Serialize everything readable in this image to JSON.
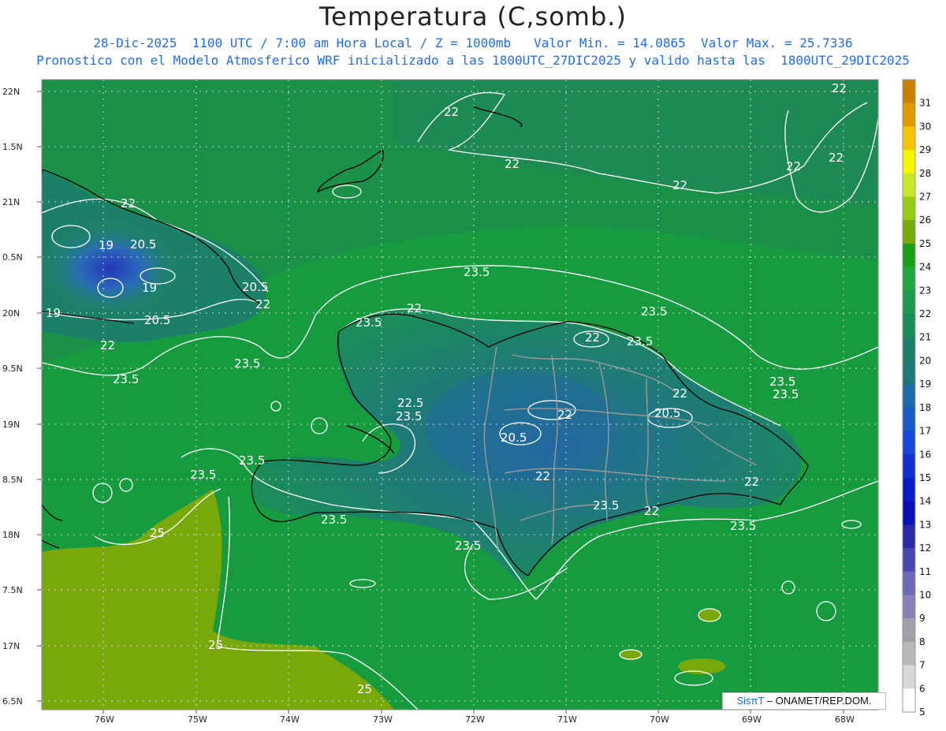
{
  "header": {
    "title": "Temperatura (C,somb.)",
    "subtitle_line1": "28-Dic-2025  1100 UTC / 7:00 am Hora Local / Z = 1000mb   Valor Min. = 14.0865  Valor Max. = 25.7336",
    "subtitle_line2": "Pronostico con el Modelo Atmosferico WRF inicializado a las 1800UTC_27DIC2025 y valido hasta las  1800UTC_29DIC2025"
  },
  "map": {
    "lat_labels": [
      "22N",
      "1.5N",
      "21N",
      "0.5N",
      "20N",
      "9.5N",
      "19N",
      "8.5N",
      "18N",
      "7.5N",
      "17N",
      "6.5N"
    ],
    "lon_labels": [
      "76W",
      "75W",
      "74W",
      "73W",
      "72W",
      "71W",
      "70W",
      "69W",
      "68W"
    ],
    "contour_labels": [
      "22",
      "22",
      "22",
      "22",
      "22",
      "22",
      "19",
      "20.5",
      "19",
      "20.5",
      "19",
      "20.5",
      "22",
      "22",
      "23.5",
      "23.5",
      "22",
      "23.5",
      "23.5",
      "23.5",
      "22",
      "23.5",
      "23.5",
      "22.5",
      "22",
      "23.5",
      "23.5",
      "20.5",
      "20.5",
      "22",
      "22",
      "22",
      "22",
      "23.5",
      "23.5",
      "23.5",
      "22",
      "23.5",
      "25",
      "25",
      "25"
    ],
    "colors": {
      "sea_deep": "#179b3f",
      "sea_cool": "#1c8e50",
      "land_warm": "#78a80a",
      "cold_blue": "#2a6bb8",
      "contour": "#ffffff",
      "border": "#888888",
      "coast": "#000000"
    }
  },
  "colorbar": {
    "labels": [
      "31",
      "30",
      "29",
      "28",
      "27",
      "26",
      "25",
      "24",
      "23",
      "22",
      "21",
      "20",
      "19",
      "18",
      "17",
      "16",
      "15",
      "14",
      "13",
      "12",
      "11",
      "10",
      "9",
      "8",
      "7",
      "6",
      "5"
    ],
    "colors": [
      "#c88000",
      "#e09a00",
      "#f5c400",
      "#f5f500",
      "#c8e628",
      "#98cc14",
      "#78a80a",
      "#18a018",
      "#1ca83c",
      "#1c9a4e",
      "#1a8c58",
      "#1c8068",
      "#227878",
      "#1c6aa8",
      "#1a5ac8",
      "#1848d8",
      "#1030d0",
      "#0a1ec8",
      "#0a10b4",
      "#2a2aa8",
      "#4848b0",
      "#6a6ab8",
      "#8a80b8",
      "#a0a0a8",
      "#b8b8b8",
      "#d8d8d8",
      "#ffffff"
    ]
  },
  "credit": {
    "brand": "SisπT",
    "text": "– ONAMET/REP.DOM."
  }
}
